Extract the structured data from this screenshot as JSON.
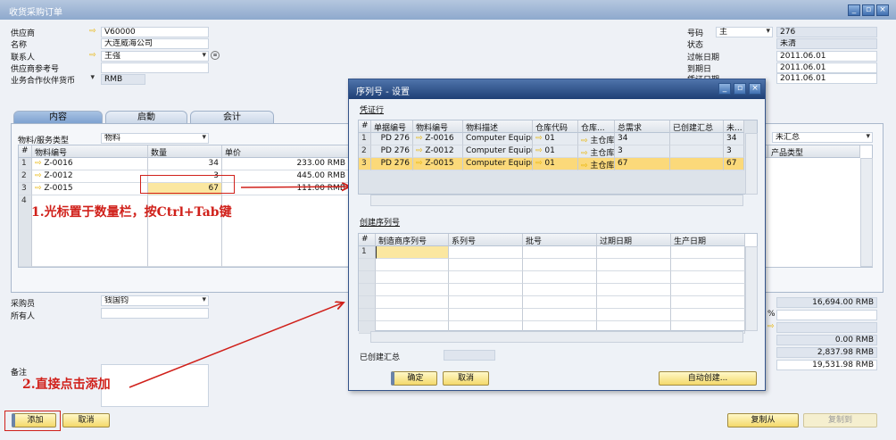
{
  "window": {
    "title": "收货采购订单",
    "controls": [
      "_",
      "▫",
      "×"
    ]
  },
  "header_left": {
    "vendor_label": "供应商",
    "vendor_value": "V60000",
    "name_label": "名称",
    "name_value": "大连威海公司",
    "contact_label": "联系人",
    "contact_value": "王强",
    "vendor_ref_label": "供应商参考号",
    "vendor_ref_value": "",
    "currency_label": "业务合作伙伴货币",
    "currency_value": "RMB"
  },
  "header_right": {
    "number_label": "号码",
    "series_value": "主",
    "number_value": "276",
    "status_label": "状态",
    "status_value": "未清",
    "posting_date_label": "过帐日期",
    "posting_date_value": "2011.06.01",
    "due_date_label": "到期日",
    "due_date_value": "2011.06.01",
    "doc_date_label": "凭证日期",
    "doc_date_value": "2011.06.01"
  },
  "tabs": [
    "内容",
    "启動",
    "会计"
  ],
  "content": {
    "type_label": "物料/服务类型",
    "type_value": "物料",
    "summary_value": "未汇总",
    "columns": [
      "#",
      "物料编号",
      "数量",
      "单价"
    ],
    "extra_column": "产品类型",
    "rows": [
      {
        "n": "1",
        "item": "Z-0016",
        "qty": "34",
        "price": "233.00 RMB"
      },
      {
        "n": "2",
        "item": "Z-0012",
        "qty": "3",
        "price": "445.00 RMB"
      },
      {
        "n": "3",
        "item": "Z-0015",
        "qty": "67",
        "price": "111.00 RMB"
      },
      {
        "n": "4",
        "item": "",
        "qty": "",
        "price": ""
      }
    ]
  },
  "footer_left": {
    "buyer_label": "采购员",
    "buyer_value": "钱国钧",
    "owner_label": "所有人",
    "owner_value": "",
    "remarks_label": "备注"
  },
  "totals": {
    "before_discount": "16,694.00 RMB",
    "discount_unit": "%",
    "freight": "",
    "rounding": "0.00 RMB",
    "tax": "2,837.98 RMB",
    "total": "19,531.98 RMB"
  },
  "buttons": {
    "add": "添加",
    "cancel": "取消",
    "copy_from": "复制从",
    "copy_to": "复制到"
  },
  "annotations": {
    "step1": "1.光标置于数量栏，按Ctrl+Tab键",
    "step2": "2.直接点击添加"
  },
  "dialog": {
    "title": "序列号 - 设置",
    "doc_lines_label": "凭证行",
    "columns": [
      "#",
      "单据编号",
      "物料编号",
      "物料描述",
      "仓库代码",
      "仓库...",
      "总需求",
      "已创建汇总",
      "未..."
    ],
    "rows": [
      [
        "1",
        "PD 276",
        "Z-0016",
        "Computer Equipmer",
        "01",
        "主仓库",
        "34",
        "",
        "34"
      ],
      [
        "2",
        "PD 276",
        "Z-0012",
        "Computer Equipmer",
        "01",
        "主仓库",
        "3",
        "",
        "3"
      ],
      [
        "3",
        "PD 276",
        "Z-0015",
        "Computer Equipmer",
        "01",
        "主仓库",
        "67",
        "",
        "67"
      ]
    ],
    "create_label": "创建序列号",
    "serial_columns": [
      "#",
      "制造商序列号",
      "系列号",
      "批号",
      "过期日期",
      "生产日期"
    ],
    "serial_rows": [
      [
        "1",
        "",
        "",
        "",
        "",
        ""
      ]
    ],
    "created_total_label": "已创建汇总",
    "created_total_value": "",
    "ok": "确定",
    "cancel": "取消",
    "auto_create": "自动创建..."
  }
}
